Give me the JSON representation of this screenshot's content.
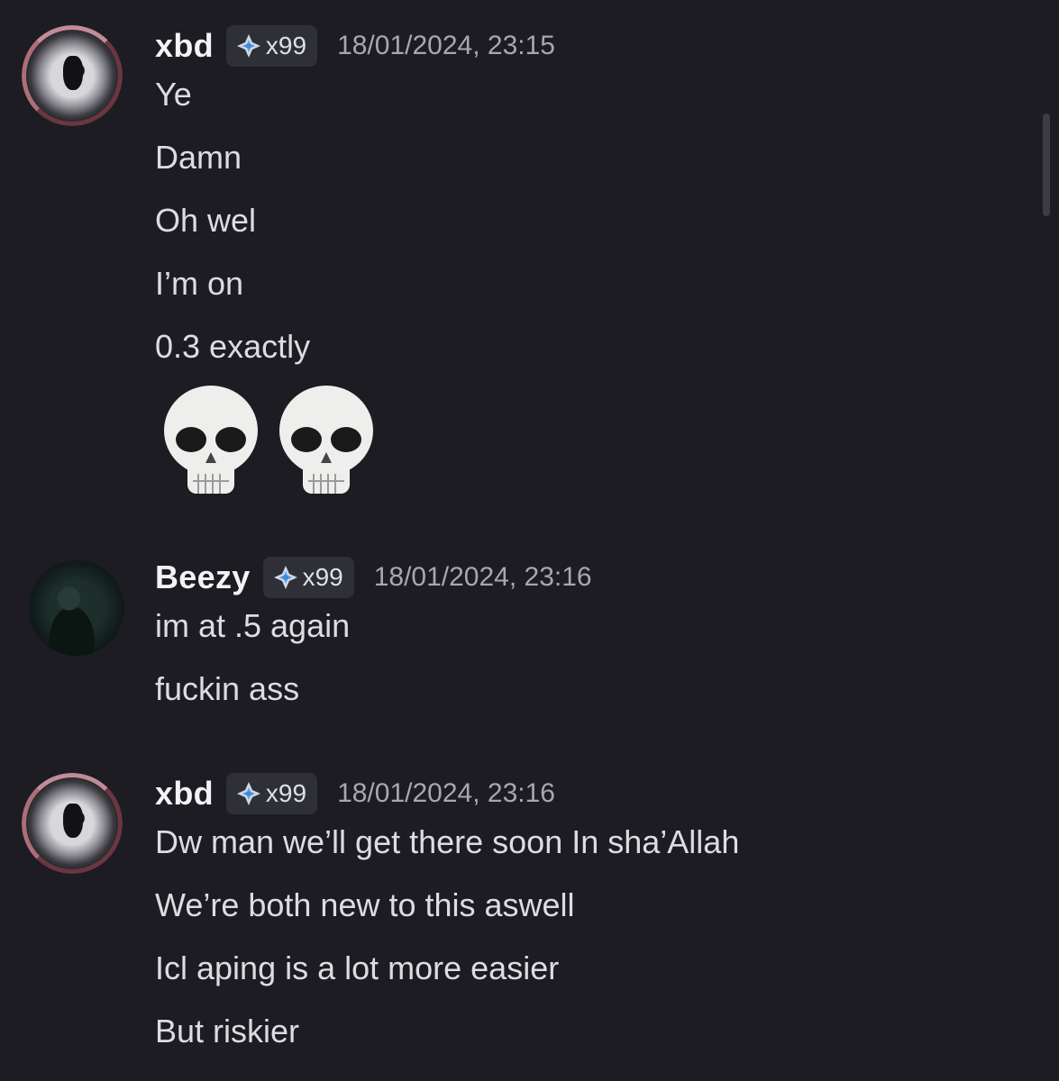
{
  "messages": [
    {
      "username": "xbd",
      "tag": "x99",
      "timestamp": "18/01/2024, 23:15",
      "lines": [
        "Ye",
        "Damn",
        "Oh wel",
        "I’m on",
        "0.3 exactly"
      ],
      "emoji": [
        "skull",
        "skull"
      ]
    },
    {
      "username": "Beezy",
      "tag": "x99",
      "timestamp": "18/01/2024, 23:16",
      "lines": [
        "im at .5 again",
        "fuckin ass"
      ]
    },
    {
      "username": "xbd",
      "tag": "x99",
      "timestamp": "18/01/2024, 23:16",
      "lines": [
        "Dw man we’ll get there soon In sha’Allah",
        "We’re both new to this aswell",
        "Icl aping is a lot more easier",
        "But riskier"
      ]
    }
  ],
  "colors": {
    "background": "#1c1c22",
    "username": "#f2f3f5",
    "timestamp": "#a6a8b0",
    "tag_background": "#2e2f37",
    "gem_accent": "#5aa9f0"
  },
  "icons": {
    "tag_icon": "diamond-gem-icon",
    "emoji": "skull-emoji"
  }
}
